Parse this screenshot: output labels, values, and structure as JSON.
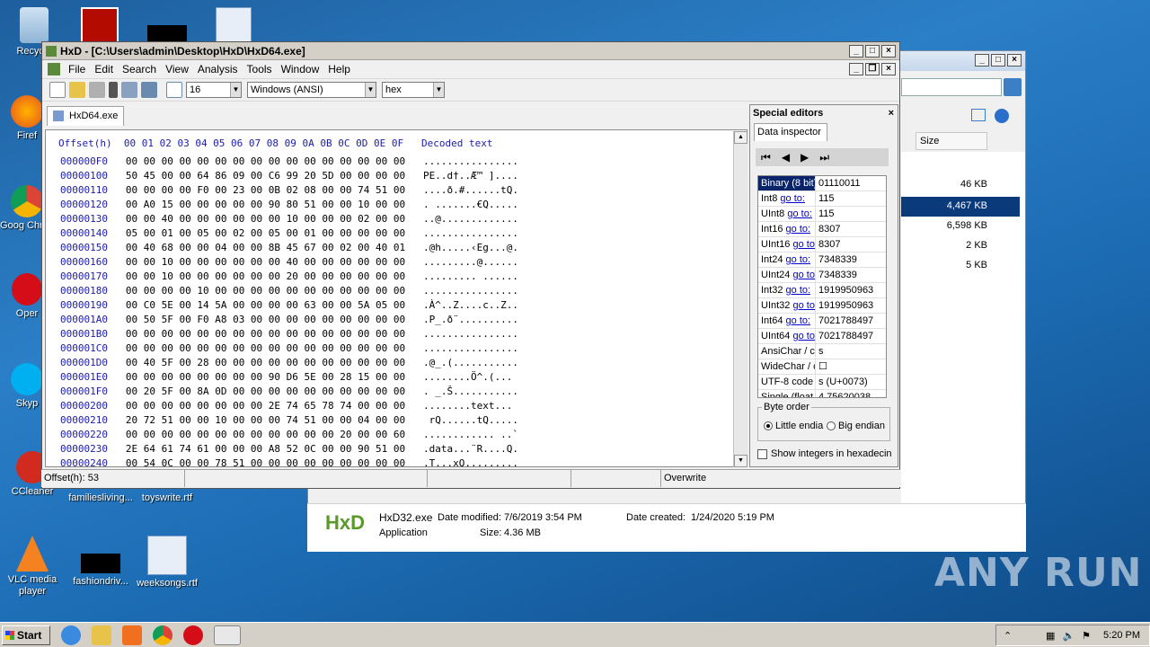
{
  "desktop": {
    "icons": [
      {
        "label": "Recycle"
      },
      {
        "label": "Firef"
      },
      {
        "label": "Goog Chron"
      },
      {
        "label": "Oper"
      },
      {
        "label": "Skyp"
      },
      {
        "label": "CCleaner"
      },
      {
        "label": "familiesliving..."
      },
      {
        "label": "toyswrite.rtf"
      },
      {
        "label": "VLC media player"
      },
      {
        "label": "fashiondriv..."
      },
      {
        "label": "weeksongs.rtf"
      }
    ]
  },
  "explorer": {
    "column_size": "Size",
    "sizes": [
      "46 KB",
      "4,467 KB",
      "6,598 KB",
      "2 KB",
      "5 KB"
    ],
    "details": {
      "name": "HxD32.exe",
      "type": "Application",
      "modified_label": "Date modified:",
      "modified": "7/6/2019 3:54 PM",
      "created_label": "Date created:",
      "created": "1/24/2020 5:19 PM",
      "size_label": "Size:",
      "size": "4.36 MB"
    }
  },
  "hxd": {
    "title": "HxD - [C:\\Users\\admin\\Desktop\\HxD\\HxD64.exe]",
    "menu": [
      "File",
      "Edit",
      "Search",
      "View",
      "Analysis",
      "Tools",
      "Window",
      "Help"
    ],
    "toolbar": {
      "bytes_per_row": "16",
      "charset": "Windows (ANSI)",
      "mode": "hex"
    },
    "tab": "HxD64.exe",
    "header": "Offset(h)  00 01 02 03 04 05 06 07 08 09 0A 0B 0C 0D 0E 0F   Decoded text",
    "rows": [
      {
        "off": "000000F0",
        "bytes": "00 00 00 00 00 00 00 00 00 00 00 00 00 00 00 00",
        "dec": "................"
      },
      {
        "off": "00000100",
        "bytes": "50 45 00 00 64 86 09 00 C6 99 20 5D 00 00 00 00",
        "dec": "PE..d†..Æ™ ]...."
      },
      {
        "off": "00000110",
        "bytes": "00 00 00 00 F0 00 23 00 0B 02 08 00 00 74 51 00",
        "dec": "....ð.#......tQ."
      },
      {
        "off": "00000120",
        "bytes": "00 A0 15 00 00 00 00 00 90 80 51 00 00 10 00 00",
        "dec": ". .......€Q....."
      },
      {
        "off": "00000130",
        "bytes": "00 00 40 00 00 00 00 00 00 10 00 00 00 02 00 00",
        "dec": "..@............."
      },
      {
        "off": "00000140",
        "bytes": "05 00 01 00 05 00 02 00 05 00 01 00 00 00 00 00",
        "dec": "................"
      },
      {
        "off": "00000150",
        "bytes": "00 40 68 00 00 04 00 00 8B 45 67 00 02 00 40 01",
        "dec": ".@h.....‹Eg...@."
      },
      {
        "off": "00000160",
        "bytes": "00 00 10 00 00 00 00 00 00 40 00 00 00 00 00 00",
        "dec": ".........@......"
      },
      {
        "off": "00000170",
        "bytes": "00 00 10 00 00 00 00 00 00 20 00 00 00 00 00 00",
        "dec": "......... ......"
      },
      {
        "off": "00000180",
        "bytes": "00 00 00 00 10 00 00 00 00 00 00 00 00 00 00 00",
        "dec": "................"
      },
      {
        "off": "00000190",
        "bytes": "00 C0 5E 00 14 5A 00 00 00 00 63 00 00 5A 05 00",
        "dec": ".À^..Z....c..Z.."
      },
      {
        "off": "000001A0",
        "bytes": "00 50 5F 00 F0 A8 03 00 00 00 00 00 00 00 00 00",
        "dec": ".P_.ð¨.........."
      },
      {
        "off": "000001B0",
        "bytes": "00 00 00 00 00 00 00 00 00 00 00 00 00 00 00 00",
        "dec": "................"
      },
      {
        "off": "000001C0",
        "bytes": "00 00 00 00 00 00 00 00 00 00 00 00 00 00 00 00",
        "dec": "................"
      },
      {
        "off": "000001D0",
        "bytes": "00 40 5F 00 28 00 00 00 00 00 00 00 00 00 00 00",
        "dec": ".@_.(..........."
      },
      {
        "off": "000001E0",
        "bytes": "00 00 00 00 00 00 00 00 90 D6 5E 00 28 15 00 00",
        "dec": "........Ö^.(..."
      },
      {
        "off": "000001F0",
        "bytes": "00 20 5F 00 8A 0D 00 00 00 00 00 00 00 00 00 00",
        "dec": ". _.Š..........."
      },
      {
        "off": "00000200",
        "bytes": "00 00 00 00 00 00 00 00 2E 74 65 78 74 00 00 00",
        "dec": "........text..."
      },
      {
        "off": "00000210",
        "bytes": "20 72 51 00 00 10 00 00 00 74 51 00 00 04 00 00",
        "dec": " rQ......tQ....."
      },
      {
        "off": "00000220",
        "bytes": "00 00 00 00 00 00 00 00 00 00 00 00 20 00 00 60",
        "dec": "............ ..`"
      },
      {
        "off": "00000230",
        "bytes": "2E 64 61 74 61 00 00 00 A8 52 0C 00 00 90 51 00",
        "dec": ".data...¨R....Q."
      },
      {
        "off": "00000240",
        "bytes": "00 54 0C 00 00 78 51 00 00 00 00 00 00 00 00 00",
        "dec": ".T...xQ........."
      }
    ],
    "status": {
      "offset": "Offset(h): 53",
      "mode": "Overwrite"
    },
    "special": {
      "title": "Special editors",
      "tab": "Data inspector",
      "rows": [
        {
          "k": "Binary (8 bit)",
          "goto": "",
          "v": "01110011"
        },
        {
          "k": "Int8",
          "goto": "go to:",
          "v": "115"
        },
        {
          "k": "UInt8",
          "goto": "go to:",
          "v": "115"
        },
        {
          "k": "Int16",
          "goto": "go to:",
          "v": "8307"
        },
        {
          "k": "UInt16",
          "goto": "go to:",
          "v": "8307"
        },
        {
          "k": "Int24",
          "goto": "go to:",
          "v": "7348339"
        },
        {
          "k": "UInt24",
          "goto": "go to:",
          "v": "7348339"
        },
        {
          "k": "Int32",
          "goto": "go to:",
          "v": "1919950963"
        },
        {
          "k": "UInt32",
          "goto": "go to:",
          "v": "1919950963"
        },
        {
          "k": "Int64",
          "goto": "go to:",
          "v": "7021788497"
        },
        {
          "k": "UInt64",
          "goto": "go to:",
          "v": "7021788497"
        },
        {
          "k": "AnsiChar / ch",
          "goto": "",
          "v": "s"
        },
        {
          "k": "WideChar / c",
          "goto": "",
          "v": "☐"
        },
        {
          "k": "UTF-8 code p",
          "goto": "",
          "v": "s (U+0073)"
        },
        {
          "k": "Single (float",
          "goto": "",
          "v": "4.75620038"
        }
      ],
      "byte_order": "Byte order",
      "little": "Little endia",
      "big": "Big endian",
      "show_hex": "Show integers in hexadecin"
    }
  },
  "taskbar": {
    "start": "Start",
    "time": "5:20 PM"
  },
  "watermark": "ANY RUN"
}
